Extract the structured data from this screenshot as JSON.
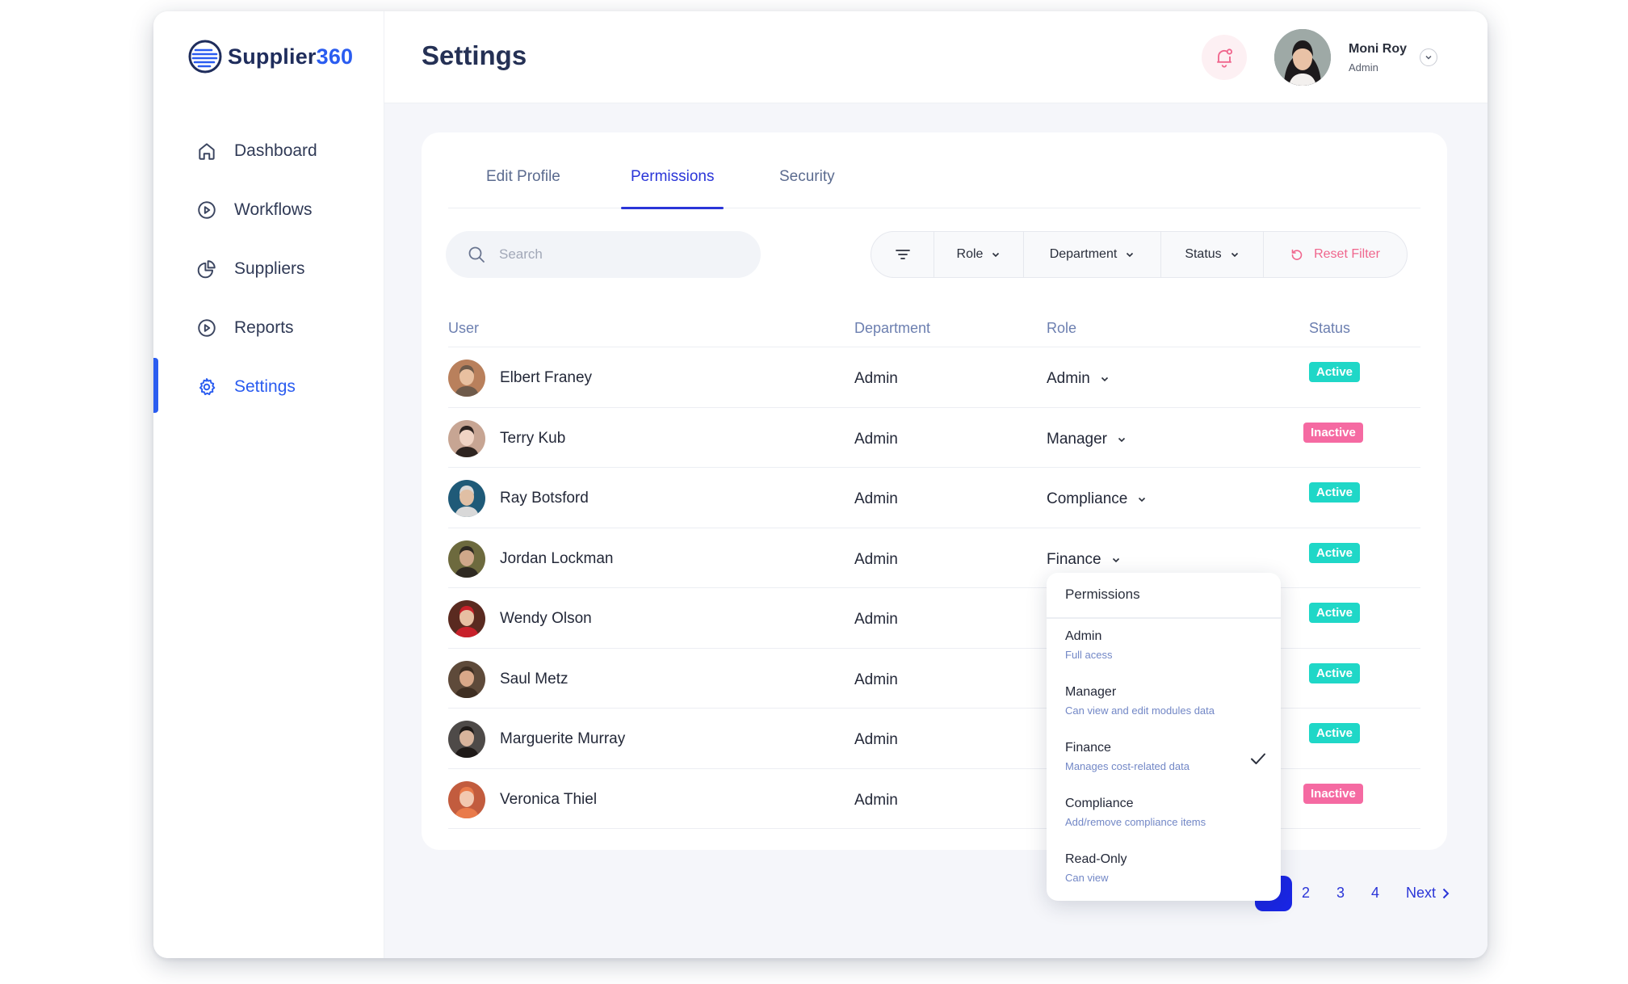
{
  "app": {
    "logo_text": "Supplier",
    "logo_number": "360"
  },
  "sidebar": {
    "items": [
      {
        "label": "Dashboard",
        "icon": "home-icon"
      },
      {
        "label": "Workflows",
        "icon": "play-circle-icon"
      },
      {
        "label": "Suppliers",
        "icon": "pie-chart-icon"
      },
      {
        "label": "Reports",
        "icon": "play-circle-icon"
      },
      {
        "label": "Settings",
        "icon": "gear-icon",
        "active": true
      }
    ]
  },
  "header": {
    "title": "Settings",
    "user": {
      "name": "Moni Roy",
      "role": "Admin"
    }
  },
  "tabs": [
    {
      "label": "Edit Profile"
    },
    {
      "label": "Permissions",
      "active": true
    },
    {
      "label": "Security"
    }
  ],
  "search": {
    "placeholder": "Search"
  },
  "filters": {
    "role": "Role",
    "department": "Department",
    "status": "Status",
    "reset": "Reset Filter"
  },
  "table": {
    "columns": {
      "user": "User",
      "department": "Department",
      "role": "Role",
      "status": "Status"
    },
    "rows": [
      {
        "name": "Elbert Franey",
        "department": "Admin",
        "role": "Admin",
        "status": "Active"
      },
      {
        "name": "Terry Kub",
        "department": "Admin",
        "role": "Manager",
        "status": "Inactive"
      },
      {
        "name": "Ray Botsford",
        "department": "Admin",
        "role": "Compliance",
        "status": "Active"
      },
      {
        "name": "Jordan Lockman",
        "department": "Admin",
        "role": "Finance",
        "status": "Active"
      },
      {
        "name": "Wendy Olson",
        "department": "Admin",
        "role": "",
        "status": "Active"
      },
      {
        "name": "Saul Metz",
        "department": "Admin",
        "role": "",
        "status": "Active"
      },
      {
        "name": "Marguerite Murray",
        "department": "Admin",
        "role": "",
        "status": "Active"
      },
      {
        "name": "Veronica Thiel",
        "department": "Admin",
        "role": "",
        "status": "Inactive"
      }
    ]
  },
  "permissions_dropdown": {
    "title": "Permissions",
    "options": [
      {
        "name": "Admin",
        "desc": "Full acess"
      },
      {
        "name": "Manager",
        "desc": "Can view and edit modules data"
      },
      {
        "name": "Finance",
        "desc": "Manages cost-related data",
        "selected": true
      },
      {
        "name": "Compliance",
        "desc": "Add/remove compliance items"
      },
      {
        "name": "Read-Only",
        "desc": "Can view"
      }
    ]
  },
  "pagination": {
    "pages": [
      "2",
      "3",
      "4"
    ],
    "next": "Next"
  },
  "colors": {
    "accent": "#2a5cf0",
    "tab_accent": "#2a35d8",
    "active_badge": "#1fd7c7",
    "inactive_badge": "#f56aa2",
    "reset": "#f0668d"
  }
}
